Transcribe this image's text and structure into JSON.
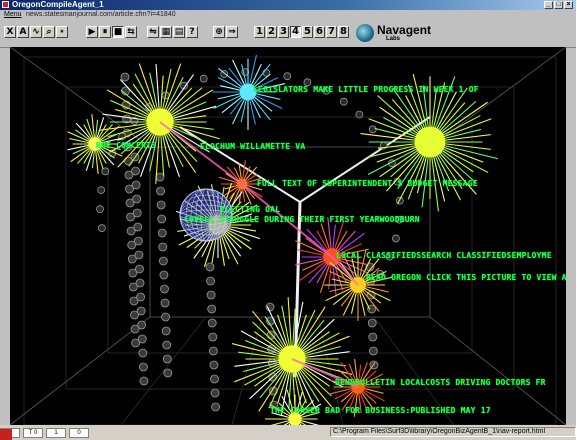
{
  "window": {
    "title": "OregonCompileAgent_1",
    "controls": [
      "_",
      "□",
      "×"
    ]
  },
  "menubar": {
    "menu_label": "Menu",
    "url": "news.statesmanjournal.com/article.cfm?i=41840"
  },
  "toolbar": {
    "view_tools": [
      "X",
      "A",
      "∿",
      "⌕",
      "⋆"
    ],
    "playback": [
      "▶",
      "⏸",
      "■",
      "⇆"
    ],
    "misc": [
      "⇋",
      "▦",
      "▤",
      "?"
    ],
    "nav": [
      "⊕",
      "⇒"
    ],
    "numbers": [
      "1",
      "2",
      "3",
      "4",
      "5",
      "6",
      "7",
      "8"
    ],
    "selected_number": "4",
    "brand_name": "Navagent",
    "brand_sub": "Labs"
  },
  "viewport": {
    "labels": [
      "LEGISLATORS MAKE LITTLE PROGRESS IN WEEK 1 OF",
      "NUE CONCERTS",
      "ELOCHUM WILLAMETTE VA",
      "FULL TEXT OF SUPERINTENDENT S BUDGET MESSAGE",
      "ELECTING OAL",
      "COVELL STRUGGLE DURING THEIR FIRST YEARWOODBURN",
      "LOCAL CLASSIFIEDSSEARCH CLASSIFIEDSEMPLOYME",
      "READ OREGON CLICK THIS PICTURE TO VIEW A L",
      "BENDBULLETIN LOCALCOSTS DRIVING DOCTORS FR",
      "THE CORNER BAD FOR BUSINESS:PUBLISHED MAY 17"
    ]
  },
  "status": {
    "fields": [
      "0",
      "T 0",
      "1",
      "0"
    ],
    "path": "C:\\Program Files\\Surf3D\\library\\OregonBizAgentB_1\\nav-report.html"
  }
}
